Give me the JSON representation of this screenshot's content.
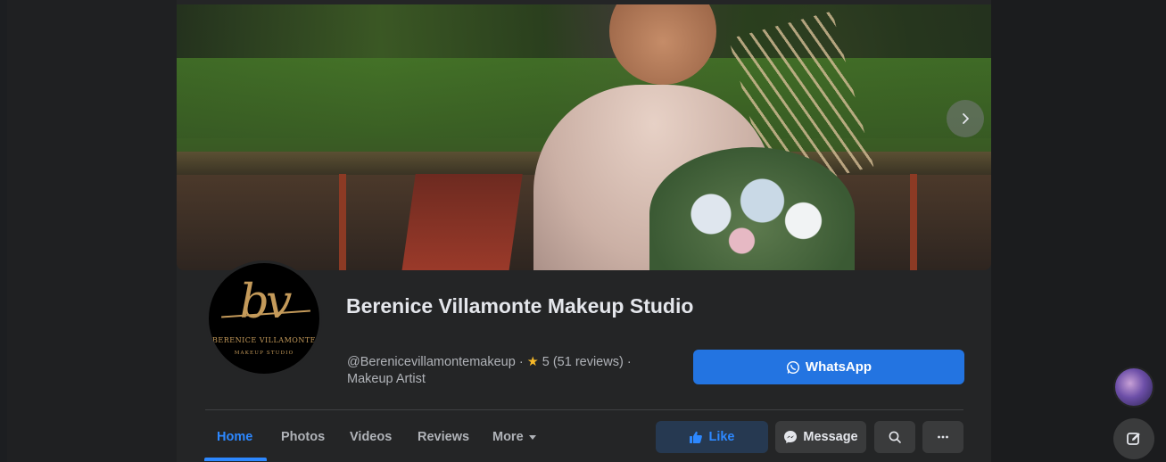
{
  "page": {
    "title": "Berenice Villamonte Makeup Studio",
    "username": "@Berenicevillamontemakeup",
    "separator": " · ",
    "rating": "5 (51 reviews)",
    "category": "Makeup Artist"
  },
  "avatar": {
    "monogram": "bv",
    "line1": "BERENICE VILLAMONTE",
    "line2": "MAKEUP STUDIO"
  },
  "cta": {
    "whatsapp_label": "WhatsApp"
  },
  "tabs": [
    {
      "label": "Home",
      "active": true
    },
    {
      "label": "Photos"
    },
    {
      "label": "Videos"
    },
    {
      "label": "Reviews"
    },
    {
      "label": "More"
    }
  ],
  "actions": {
    "like_label": "Like",
    "message_label": "Message"
  },
  "icons": {
    "next": "chevron-right-icon",
    "star": "star-icon",
    "whatsapp": "whatsapp-icon",
    "like": "thumbs-up-icon",
    "message": "messenger-icon",
    "search": "search-icon",
    "more": "more-icon",
    "compose": "compose-icon"
  },
  "colors": {
    "accent": "#2d88ff",
    "button_primary": "#2374e1",
    "background": "#242526",
    "star": "#f7b928"
  }
}
